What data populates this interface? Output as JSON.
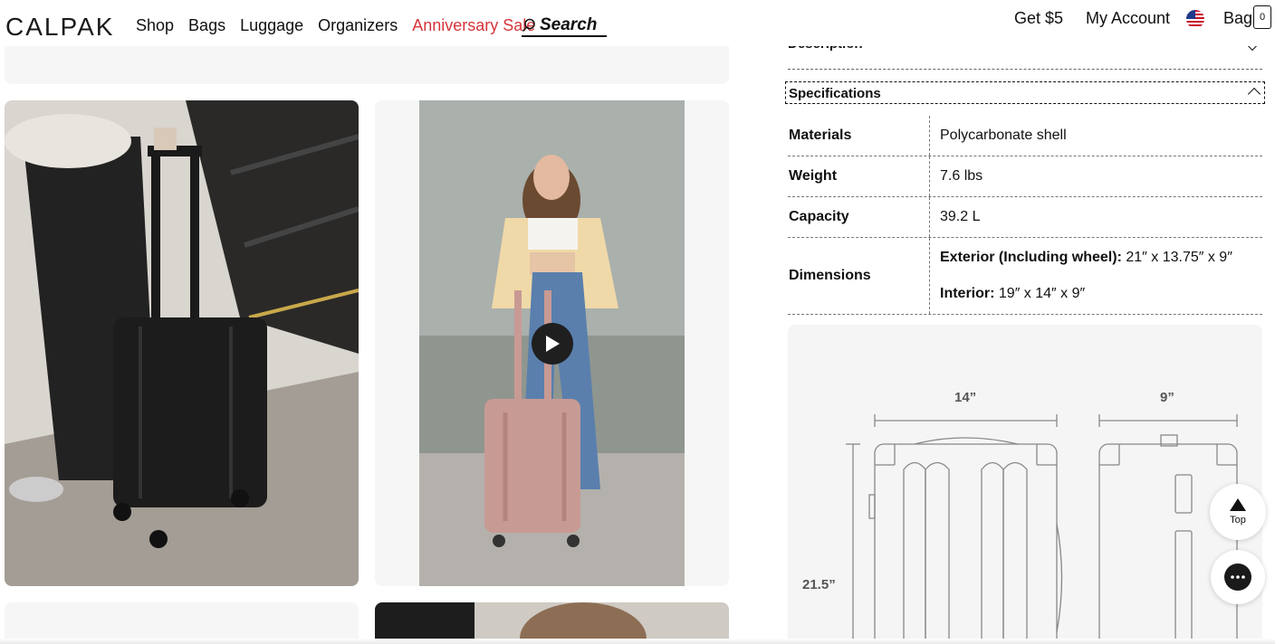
{
  "header": {
    "logo": "CALPAK",
    "nav": [
      "Shop",
      "Bags",
      "Luggage",
      "Organizers"
    ],
    "sale": "Anniversary Sale",
    "search_label": "Search",
    "get5": "Get $5",
    "account": "My Account",
    "bag": "Bag",
    "bag_count": "0"
  },
  "product": {
    "description_label": "Description",
    "specs_label": "Specifications",
    "specs": [
      {
        "key": "Materials",
        "value": "Polycarbonate shell"
      },
      {
        "key": "Weight",
        "value": "7.6 lbs"
      },
      {
        "key": "Capacity",
        "value": "39.2 L"
      }
    ],
    "dimensions_key": "Dimensions",
    "dim_ext_label": "Exterior (Including wheel):",
    "dim_ext_value": " 21″ x 13.75″ x 9″",
    "dim_int_label": "Interior:",
    "dim_int_value": " 19″ x 14″ x 9″",
    "diagram": {
      "width": "14”",
      "depth": "9”",
      "height": "21.5”"
    }
  },
  "floating": {
    "top_label": "Top"
  },
  "colors": {
    "accent_sale": "#d6353a",
    "text": "#111111",
    "panel_bg": "#f6f6f6"
  }
}
